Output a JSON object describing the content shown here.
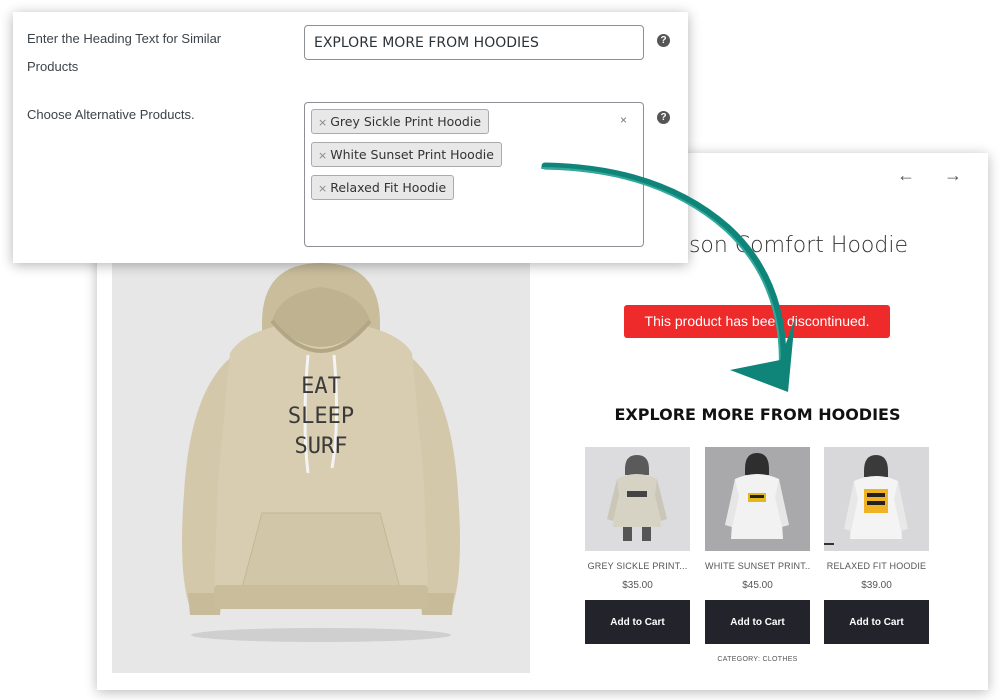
{
  "admin": {
    "heading_label": "Enter the Heading Text for Similar Products",
    "heading_value": "EXPLORE MORE FROM HOODIES",
    "alt_label": "Choose Alternative Products.",
    "help_glyph": "?",
    "clear_glyph": "×",
    "tag_remove_glyph": "×",
    "selected_products": [
      "Grey Sickle Print Hoodie",
      "White Sunset Print Hoodie",
      "Relaxed Fit Hoodie"
    ]
  },
  "product": {
    "nav_prev": "←",
    "nav_next": "→",
    "title": "Crimson Comfort Hoodie",
    "discontinued_notice": "This product has been discontinued.",
    "hoodie_print_lines": [
      "EAT",
      "SLEEP",
      "SURF"
    ],
    "similar_heading": "EXPLORE MORE FROM HOODIES",
    "similar_items": [
      {
        "name": "GREY SICKLE PRINT...",
        "price": "$35.00",
        "button": "Add to Cart"
      },
      {
        "name": "WHITE SUNSET PRINT...",
        "price": "$45.00",
        "button": "Add to Cart"
      },
      {
        "name": "RELAXED FIT HOODIE",
        "price": "$39.00",
        "button": "Add to Cart"
      }
    ],
    "category_text": "CATEGORY: CLOTHES"
  },
  "colors": {
    "discontinued_bg": "#ee2a2a",
    "button_bg": "#23232b",
    "arrow": "#0f857a",
    "hoodie_main": "#d8cdb0"
  }
}
